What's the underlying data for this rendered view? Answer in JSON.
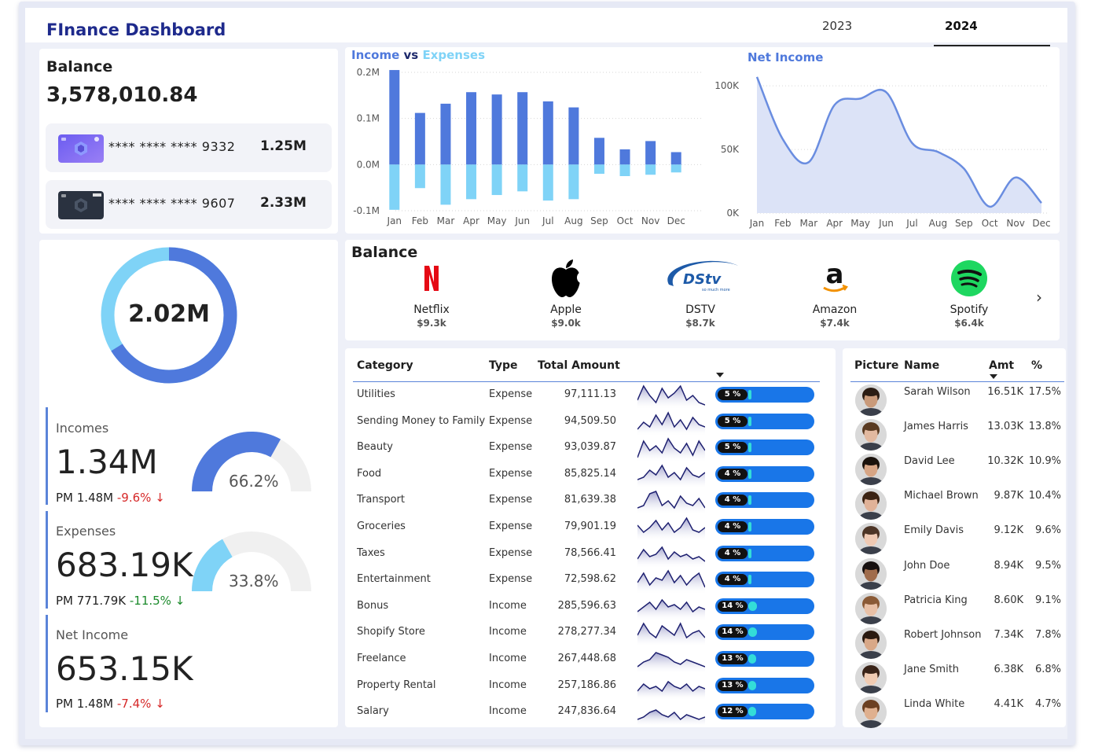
{
  "header": {
    "title": "FInance Dashboard",
    "years": [
      "2023",
      "2024"
    ],
    "selected_year": "2024"
  },
  "balance": {
    "label": "Balance",
    "amount": "3,578,010.84",
    "cards": [
      {
        "number": "**** **** **** 9332",
        "amount": "1.25M",
        "style": "purple"
      },
      {
        "number": "**** **** **** 9607",
        "amount": "2.33M",
        "style": "dark"
      }
    ]
  },
  "donut": {
    "value": "2.02M",
    "income_share": 0.662
  },
  "kpis": {
    "incomes": {
      "label": "Incomes",
      "value": "1.34M",
      "pm_label": "PM 1.48M",
      "pm_change": "-9.6%",
      "gauge_pct": "66.2%",
      "gauge_frac": 0.662
    },
    "expenses": {
      "label": "Expenses",
      "value": "683.19K",
      "pm_label": "PM 771.79K",
      "pm_change": "-11.5%",
      "gauge_pct": "33.8%",
      "gauge_frac": 0.338
    },
    "net": {
      "label": "Net Income",
      "value": "653.15K",
      "pm_label": "PM 1.48M",
      "pm_change": "-7.4%"
    }
  },
  "chart_data": [
    {
      "type": "bar",
      "title_income": "Income",
      "title_vs": "vs",
      "title_expenses": "Expenses",
      "categories": [
        "Jan",
        "Feb",
        "Mar",
        "Apr",
        "May",
        "Jun",
        "Jul",
        "Aug",
        "Sep",
        "Oct",
        "Nov",
        "Dec"
      ],
      "series": [
        {
          "name": "Income",
          "color": "#4f79dc",
          "values": [
            0.205,
            0.112,
            0.132,
            0.157,
            0.152,
            0.157,
            0.137,
            0.124,
            0.058,
            0.033,
            0.051,
            0.027
          ]
        },
        {
          "name": "Expenses",
          "color": "#7fd3f7",
          "values": [
            -0.098,
            -0.051,
            -0.087,
            -0.075,
            -0.066,
            -0.058,
            -0.078,
            -0.075,
            -0.02,
            -0.025,
            -0.022,
            -0.017
          ]
        }
      ],
      "yticks": [
        "0.2M",
        "0.1M",
        "0.0M",
        "-0.1M"
      ],
      "ytick_values": [
        0.2,
        0.1,
        0.0,
        -0.1
      ],
      "ylim": [
        -0.1,
        0.2
      ]
    },
    {
      "type": "area",
      "title": "Net Income",
      "categories": [
        "Jan",
        "Feb",
        "Mar",
        "Apr",
        "May",
        "Jun",
        "Jul",
        "Aug",
        "Sep",
        "Oct",
        "Nov",
        "Dec"
      ],
      "values": [
        107000,
        58000,
        40000,
        85000,
        90000,
        95000,
        55000,
        48000,
        35000,
        5000,
        28000,
        8000
      ],
      "yticks": [
        "100K",
        "50K",
        "0K"
      ],
      "ytick_values": [
        100000,
        50000,
        0
      ],
      "ylim": [
        0,
        110000
      ],
      "color": "#6a8de0"
    }
  ],
  "subscriptions": {
    "title": "Balance",
    "items": [
      {
        "name": "Netflix",
        "amount": "$9.3k"
      },
      {
        "name": "Apple",
        "amount": "$9.0k"
      },
      {
        "name": "DSTV",
        "amount": "$8.7k"
      },
      {
        "name": "Amazon",
        "amount": "$7.4k"
      },
      {
        "name": "Spotify",
        "amount": "$6.4k"
      }
    ],
    "dstv_text": "DStv",
    "dstv_sub": "so much more"
  },
  "category_table": {
    "headers": [
      "Category",
      "Type",
      "Total Amount"
    ],
    "rows": [
      {
        "category": "Utilities",
        "type": "Expense",
        "amount": "97,111.13",
        "pct": "5 %",
        "frac": 0.05
      },
      {
        "category": "Sending Money to Family",
        "type": "Expense",
        "amount": "94,509.50",
        "pct": "5 %",
        "frac": 0.05
      },
      {
        "category": "Beauty",
        "type": "Expense",
        "amount": "93,039.87",
        "pct": "5 %",
        "frac": 0.05
      },
      {
        "category": "Food",
        "type": "Expense",
        "amount": "85,825.14",
        "pct": "4 %",
        "frac": 0.04
      },
      {
        "category": "Transport",
        "type": "Expense",
        "amount": "81,639.38",
        "pct": "4 %",
        "frac": 0.04
      },
      {
        "category": "Groceries",
        "type": "Expense",
        "amount": "79,901.19",
        "pct": "4 %",
        "frac": 0.04
      },
      {
        "category": "Taxes",
        "type": "Expense",
        "amount": "78,566.41",
        "pct": "4 %",
        "frac": 0.04
      },
      {
        "category": "Entertainment",
        "type": "Expense",
        "amount": "72,598.62",
        "pct": "4 %",
        "frac": 0.04
      },
      {
        "category": "Bonus",
        "type": "Income",
        "amount": "285,596.63",
        "pct": "14 %",
        "frac": 0.14
      },
      {
        "category": "Shopify Store",
        "type": "Income",
        "amount": "278,277.34",
        "pct": "14 %",
        "frac": 0.14
      },
      {
        "category": "Freelance",
        "type": "Income",
        "amount": "267,448.68",
        "pct": "13 %",
        "frac": 0.13
      },
      {
        "category": "Property Rental",
        "type": "Income",
        "amount": "257,186.86",
        "pct": "13 %",
        "frac": 0.13
      },
      {
        "category": "Salary",
        "type": "Income",
        "amount": "247,836.64",
        "pct": "12 %",
        "frac": 0.12
      }
    ]
  },
  "people_table": {
    "headers": [
      "Picture",
      "Name",
      "Amt",
      "%"
    ],
    "rows": [
      {
        "name": "Sarah Wilson",
        "amt": "16.51K",
        "pct": "17.5%",
        "skin": "#c99a7a",
        "hair": "#2b1d14"
      },
      {
        "name": "James Harris",
        "amt": "13.03K",
        "pct": "13.8%",
        "skin": "#e2b9a0",
        "hair": "#5a3b22"
      },
      {
        "name": "David Lee",
        "amt": "10.32K",
        "pct": "10.9%",
        "skin": "#d7a585",
        "hair": "#1a120c"
      },
      {
        "name": "Michael Brown",
        "amt": "9.87K",
        "pct": "10.4%",
        "skin": "#e0b298",
        "hair": "#3b2313"
      },
      {
        "name": "Emily Davis",
        "amt": "9.12K",
        "pct": "9.6%",
        "skin": "#efc9b3",
        "hair": "#4d3526"
      },
      {
        "name": "John Doe",
        "amt": "8.94K",
        "pct": "9.5%",
        "skin": "#a06c4c",
        "hair": "#171010"
      },
      {
        "name": "Patricia King",
        "amt": "8.60K",
        "pct": "9.1%",
        "skin": "#e8c0a6",
        "hair": "#8a5a36"
      },
      {
        "name": "Robert Johnson",
        "amt": "7.34K",
        "pct": "7.8%",
        "skin": "#d8a888",
        "hair": "#2a1a10"
      },
      {
        "name": "Jane Smith",
        "amt": "6.38K",
        "pct": "6.8%",
        "skin": "#f0cbb2",
        "hair": "#3a2418"
      },
      {
        "name": "Linda White",
        "amt": "4.41K",
        "pct": "4.7%",
        "skin": "#dfb08f",
        "hair": "#6b4022"
      }
    ]
  }
}
